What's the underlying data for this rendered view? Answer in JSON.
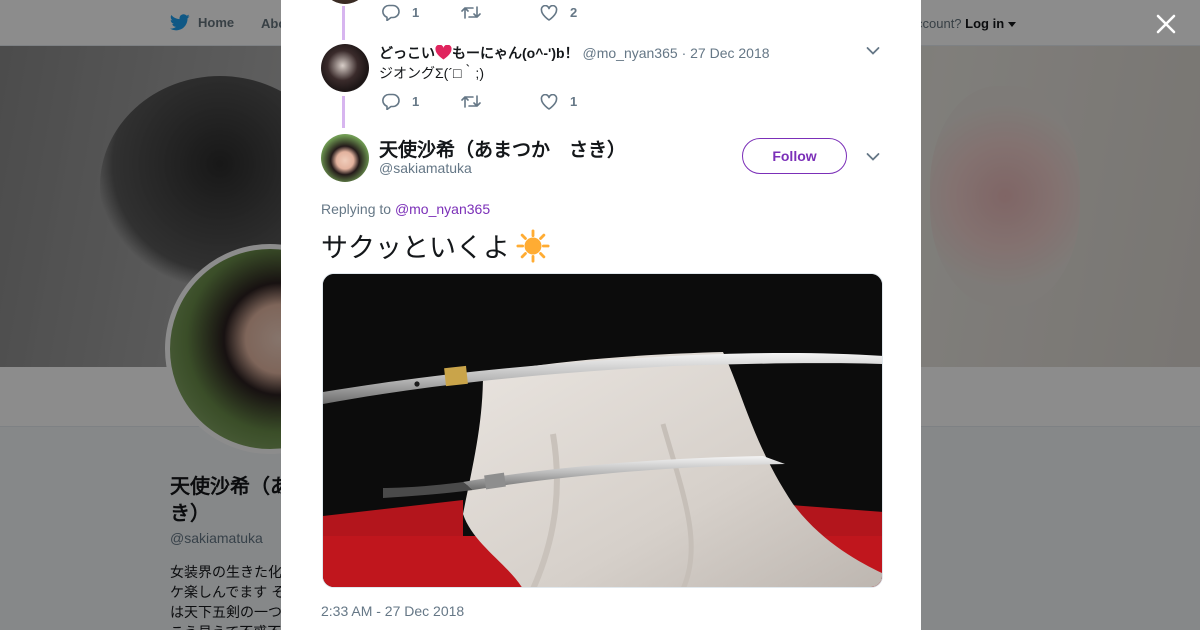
{
  "topnav": {
    "home_label": "Home",
    "about_label": "Abo",
    "login_prefix": "ccount?",
    "login_label": "Log in"
  },
  "background_profile": {
    "name": "天使沙希（あ\nき）",
    "handle": "@sakiamatuka",
    "bio": "女装界の生きた化\nケ楽しんでます そ\nは天下五剣の一つ\nこう見えて不惑不"
  },
  "reply_1_actions": {
    "reply_count": "1",
    "retweet_count": "",
    "like_count": "2"
  },
  "reply_2": {
    "name_prefix": "どっこい",
    "name_suffix": "もーにゃん(o^-')b！",
    "handle": "@mo_nyan365",
    "separator": "·",
    "date": "27 Dec 2018",
    "text": "ジオングΣ(´□｀;)",
    "actions": {
      "reply_count": "1",
      "retweet_count": "",
      "like_count": "1"
    }
  },
  "main_tweet": {
    "name": "天使沙希（あまつか　さき）",
    "handle": "@sakiamatuka",
    "follow_label": "Follow",
    "replying_prefix": "Replying to",
    "replying_handle": "@mo_nyan365",
    "text": "サクッといくよ",
    "timestamp": "2:33 AM - 27 Dec 2018"
  },
  "colors": {
    "accent": "#7b2fb8",
    "thread_line": "#d7b5ef",
    "secondary_text": "#657786",
    "twitter_blue": "#1da1f2",
    "heart_emoji": "#e0245e",
    "sun_emoji": "#ffac33"
  },
  "icons": {
    "bird": "twitter-bird-icon",
    "caret": "caret-down-icon",
    "close": "close-icon",
    "reply": "reply-icon",
    "retweet": "retweet-icon",
    "like": "heart-icon",
    "chevron": "chevron-down-icon",
    "heart_emoji": "red-heart-emoji-icon",
    "sun_emoji": "sun-emoji-icon"
  }
}
